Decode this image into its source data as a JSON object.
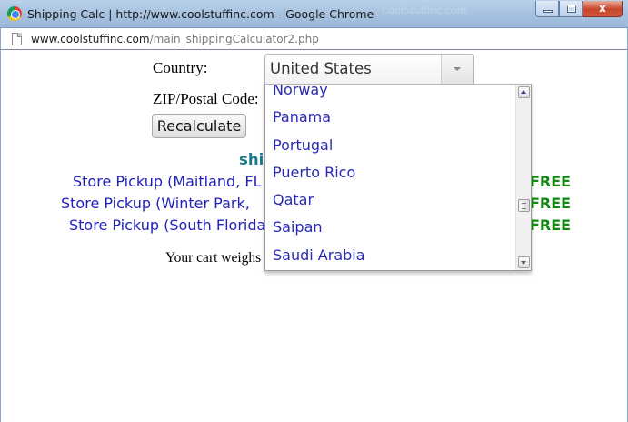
{
  "window": {
    "title": "Shipping Calc | http://www.coolstuffinc.com - Google Chrome",
    "ghost_title": "CoolStuffInc.com",
    "minimize_label": "",
    "maximize_label": "",
    "close_label": "x"
  },
  "address": {
    "host": "www.coolstuffinc.com",
    "path": "/main_shippingCalculator2.php"
  },
  "form": {
    "country_label": "Country:",
    "zip_label": "ZIP/Postal Code:",
    "country_selected": "United States",
    "recalculate_label": "Recalculate"
  },
  "dropdown": {
    "options": [
      "Norway",
      "Panama",
      "Portugal",
      "Puerto Rico",
      "Qatar",
      "Saipan",
      "Saudi Arabia"
    ]
  },
  "shipping": {
    "heading": "ship",
    "rows": [
      {
        "name": "Store Pickup (Maitland, FL",
        "price": "FREE"
      },
      {
        "name": "Store Pickup (Winter Park, ",
        "price": "FREE"
      },
      {
        "name": "Store Pickup (South Florida",
        "price": "FREE"
      }
    ]
  },
  "cart": {
    "weight_text": "Your cart weighs a"
  },
  "colors": {
    "link_blue": "#2222bb",
    "free_green": "#138a13",
    "heading_teal": "#1b7a8c"
  },
  "icons": {
    "browser": "chrome-logo-icon",
    "page": "page-icon",
    "dropdown_arrow": "chevron-down-icon"
  }
}
